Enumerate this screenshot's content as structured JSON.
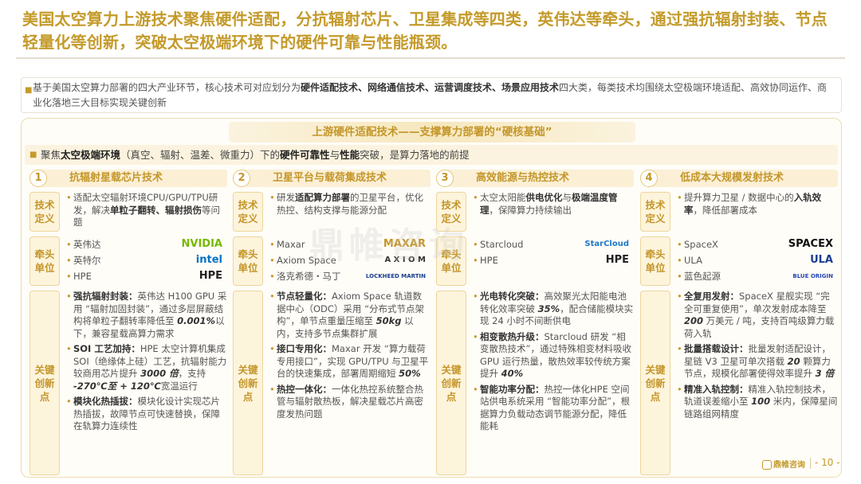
{
  "title": "美国太空算力上游技术聚焦硬件适配，分抗辐射芯片、卫星集成等四类，英伟达等牵头，通过强抗辐射封装、节点轻量化等创新，突破太空极端环境下的硬件可靠与性能瓶颈。",
  "intro": {
    "t1": "基于美国太空算力部署的四大产业环节，核心技术可对应划分为",
    "b1": "硬件适配技术、网络通信技术、运营调度技术、场景应用技术",
    "t2": "四大类，每类技术均围绕太空极端环境适配、高效协同运作、商业化落地三大目标实现关键创新"
  },
  "section": {
    "subtitle": "上游硬件适配技术——支撑算力部署的“硬核基础”",
    "t1": "聚焦",
    "b1": "太空极端环境",
    "t2": "（真空、辐射、温差、微重力）下的",
    "b2": "硬件可靠性",
    "t3": "与",
    "b3": "性能",
    "t4": "突破，是算力落地的前提"
  },
  "labels": {
    "def": "技术定义",
    "lead": "牵头单位",
    "inno": "关键创新点"
  },
  "columns": [
    {
      "num": "1",
      "title": "抗辐射星载芯片技术",
      "def": {
        "t1": "适配太空辐射环境CPU/GPU/TPU研发，解决",
        "b1": "单粒子翻转、辐射损伤",
        "t2": "等问题"
      },
      "leads": [
        {
          "name": "英伟达",
          "logo": "NVIDIA",
          "color": "#76b900"
        },
        {
          "name": "英特尔",
          "logo": "intel",
          "color": "#0071c5"
        },
        {
          "name": "HPE",
          "logo": "HPE",
          "color": "#222222"
        }
      ],
      "inno": [
        {
          "b": "强抗辐射封装：",
          "t": "英伟达 H100 GPU 采用 “辐射加固封装”，通过多层屏蔽结构将单粒子翻转率降低至 ",
          "i": "0.001%",
          "t2": "以下，兼容星载高算力需求",
          "i2": "",
          "t3": ""
        },
        {
          "b": "SOI 工艺加持：",
          "t": "HPE 太空计算机集成 SOI（绝缘体上硅）工艺，抗辐射能力较商用芯片提升 ",
          "i": "3000 倍",
          "t2": "，支持 ",
          "i2": "-270℃至 + 120℃",
          "t3": "宽温运行"
        },
        {
          "b": "模块化热插拔：",
          "t": "模块化设计实现芯片热插拔，故障节点可快速替换，保障在轨算力连续性",
          "i": "",
          "t2": "",
          "i2": "",
          "t3": ""
        }
      ]
    },
    {
      "num": "2",
      "title": "卫星平台与载荷集成技术",
      "def": {
        "t1": "研发",
        "b1": "适配算力部署",
        "t2": "的卫星平台，优化热控、结构支撑与能源分配"
      },
      "leads": [
        {
          "name": "Maxar",
          "logo": "MAXAR",
          "color": "#c4962a"
        },
        {
          "name": "Axiom Space",
          "logo": "A X I O M",
          "color": "#333333"
        },
        {
          "name": "洛克希德・马丁",
          "logo": "LOCKHEED MARTIN",
          "color": "#1a3d8f"
        }
      ],
      "inno": [
        {
          "b": "节点轻量化：",
          "t": "Axiom Space 轨道数据中心（ODC）采用 “分布式节点架构”，单节点重量压缩至 ",
          "i": "50kg",
          "t2": " 以内，支持多节点集群扩展",
          "i2": "",
          "t3": ""
        },
        {
          "b": "接口专用化：",
          "t": "Maxar 开发 “算力载荷专用接口”，实现 GPU/TPU 与卫星平台的快速集成，部署周期缩短 ",
          "i": "50%",
          "t2": "",
          "i2": "",
          "t3": ""
        },
        {
          "b": "热控一体化：",
          "t": "一体化热控系统整合热管与辐射散热板，解决星载芯片高密度发热问题",
          "i": "",
          "t2": "",
          "i2": "",
          "t3": ""
        }
      ]
    },
    {
      "num": "3",
      "title": "高效能源与热控技术",
      "def": {
        "t1": "太空太阳能",
        "b1": "供电优化",
        "t2": "与",
        "b2": "极端温度管理",
        "t3": "，保障算力持续输出"
      },
      "leads": [
        {
          "name": "Starcloud",
          "logo": "StarCloud",
          "color": "#1f78c8"
        },
        {
          "name": "HPE",
          "logo": "HPE",
          "color": "#222222"
        }
      ],
      "inno": [
        {
          "b": "光电转化突破：",
          "t": "高效聚光太阳能电池转化效率突破 ",
          "i": "35%",
          "t2": "，配合储能模块实现 24 小时不间断供电",
          "i2": "",
          "t3": ""
        },
        {
          "b": "相变散热升级：",
          "t": "Starcloud 研发 “相变散热技术”，通过特殊相变材料吸收 GPU 运行热量，散热效率较传统方案提升 ",
          "i": "40%",
          "t2": "",
          "i2": "",
          "t3": ""
        },
        {
          "b": "智能功率分配：",
          "t": "热控一体化HPE 空间站供电系统采用 “智能功率分配”，根据算力负载动态调节能源分配，降低能耗",
          "i": "",
          "t2": "",
          "i2": "",
          "t3": ""
        }
      ]
    },
    {
      "num": "4",
      "title": "低成本大规模发射技术",
      "def": {
        "t1": "提升算力卫星 / 数据中心的",
        "b1": "入轨效率",
        "t2": "，降低部署成本"
      },
      "leads": [
        {
          "name": "SpaceX",
          "logo": "SPACEX",
          "color": "#111111"
        },
        {
          "name": "ULA",
          "logo": "ULA",
          "color": "#1a3d8f"
        },
        {
          "name": "蓝色起源",
          "logo": "BLUE ORIGIN",
          "color": "#2446b8"
        }
      ],
      "inno": [
        {
          "b": "全复用发射：",
          "t": "SpaceX 星舰实现 “完全可重复使用”，单次发射成本降至 ",
          "i": "200",
          "t2": " 万美元 / 吨，支持百吨级算力载荷入轨",
          "i2": "",
          "t3": ""
        },
        {
          "b": "批量搭载设计：",
          "t": "批量发射适配设计，星链 V3 卫星可单次搭载 ",
          "i": "20",
          "t2": " 颗算力节点，规模化部署使得效率提升 ",
          "i2": "3 倍",
          "t3": ""
        },
        {
          "b": "精准入轨控制：",
          "t": "精准入轨控制技术，轨道误差缩小至 ",
          "i": "100",
          "t2": " 米内，保障星间链路组网精度",
          "i2": "",
          "t3": ""
        }
      ]
    }
  ],
  "footer": {
    "logo": "鼎帷咨询",
    "page": "- 10 -"
  },
  "watermark": "鼎帷咨询"
}
